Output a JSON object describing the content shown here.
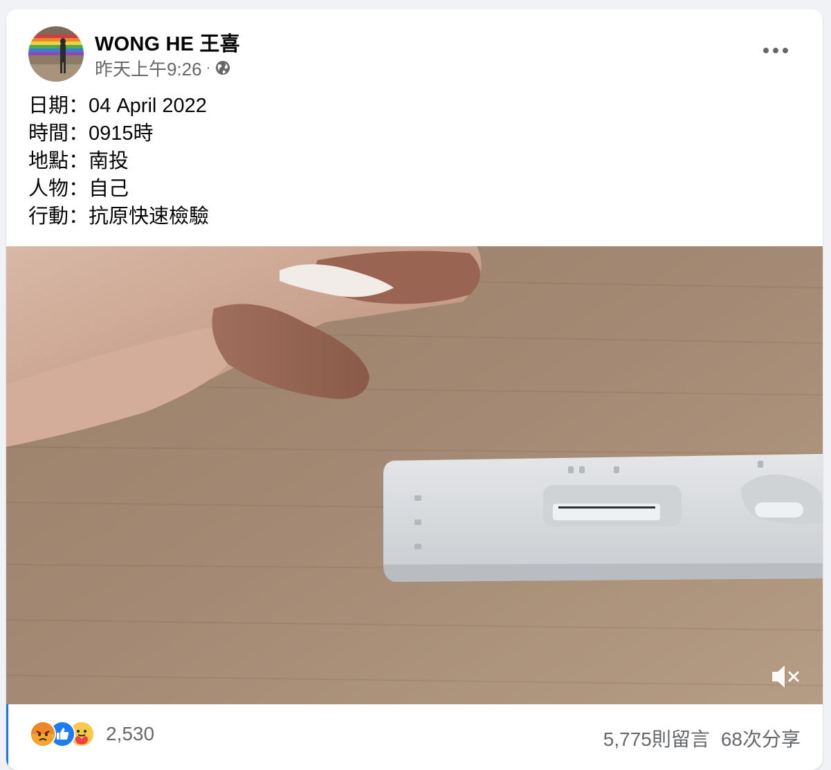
{
  "post": {
    "author": "WONG HE 王喜",
    "timestamp": "昨天上午9:26",
    "separator": "·",
    "privacy_icon": "globe-icon",
    "more_icon": "more-horizontal-icon",
    "text_lines": [
      "日期：04 April 2022",
      "時間：0915時",
      "地點：南投",
      "人物：自己",
      "行動：抗原快速檢驗"
    ]
  },
  "video": {
    "subject": "rapid antigen test cassette on wooden table",
    "mute_icon": "speaker-muted-icon"
  },
  "footer": {
    "reaction_icons": [
      "angry-reaction-icon",
      "like-reaction-icon",
      "care-reaction-icon"
    ],
    "reaction_count": "2,530",
    "comments": "5,775則留言",
    "shares": "68次分享"
  },
  "colors": {
    "text_primary": "#050505",
    "text_secondary": "#65676b",
    "like_blue": "#1877f2",
    "angry_orange": "#e9710f",
    "care_yellow": "#f7b125"
  }
}
